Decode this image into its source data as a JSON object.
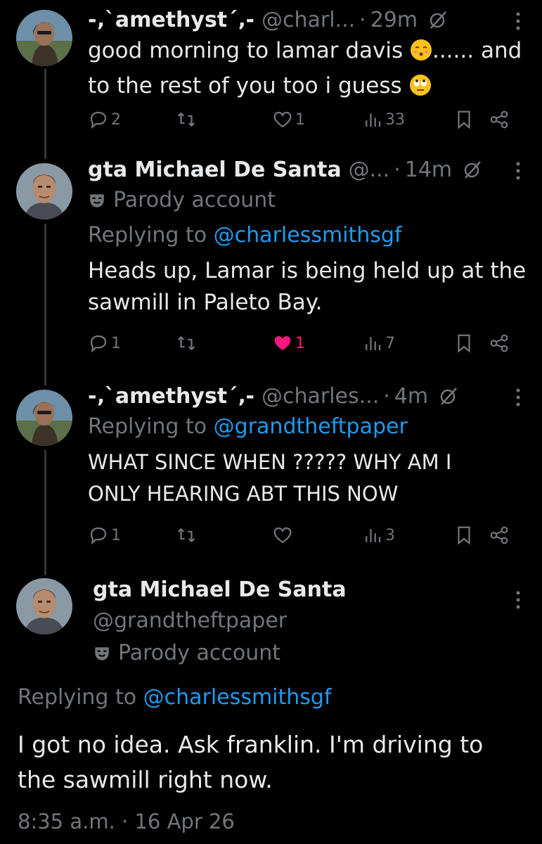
{
  "tweets": [
    {
      "name": "-‚`amethyst´‚-",
      "handle": "@charl...",
      "time": "29m",
      "text_a": "good morning to lamar davis ",
      "text_b": "...... and",
      "text_c": "to the rest of you too i guess ",
      "emoji_1": "kissing-face-emoji",
      "emoji_2": "eye-roll-emoji",
      "replies": "2",
      "reposts": "",
      "likes": "1",
      "views": "33"
    },
    {
      "name": "gta Michael De Santa",
      "handle": "@...",
      "time": "14m",
      "parody": "Parody account",
      "replying_label": "Replying to ",
      "replying_handle": "@charlessmithsgf",
      "text_a": "Heads up, Lamar is being held up at the",
      "text_b": "sawmill in Paleto Bay.",
      "replies": "1",
      "reposts": "",
      "likes": "1",
      "views": "7",
      "liked_color": "#f91880"
    },
    {
      "name": "-‚`amethyst´‚-",
      "handle": "@charles...",
      "time": "4m",
      "replying_label": "Replying to ",
      "replying_handle": "@grandtheftpaper",
      "text_a": "WHAT SINCE WHEN ????? WHY AM I",
      "text_b": "ONLY HEARING ABT THIS NOW",
      "replies": "1",
      "reposts": "",
      "likes": "",
      "views": "3"
    }
  ],
  "main_tweet": {
    "name": "gta Michael De Santa",
    "handle": "@grandtheftpaper",
    "parody": "Parody account",
    "replying_label": "Replying to ",
    "replying_handle": "@charlessmithsgf",
    "text_a": "I got no idea. Ask franklin. I'm driving to",
    "text_b": "the sawmill right now.",
    "time": "8:35 a.m.",
    "date": "16 Apr 26"
  },
  "colors": {
    "background": "#000000",
    "text": "#e7e9ea",
    "secondary": "#71767b",
    "link": "#1d9bf0",
    "like": "#f91880"
  }
}
